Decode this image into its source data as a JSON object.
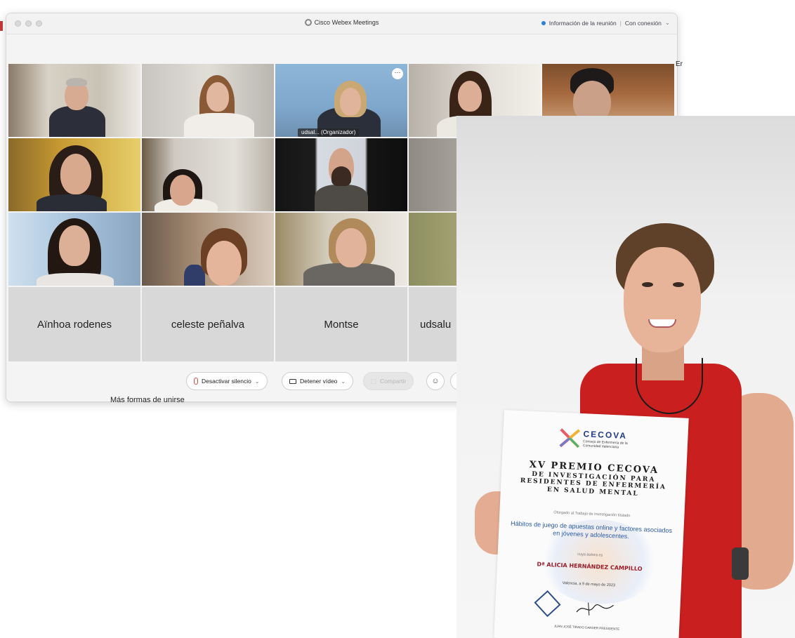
{
  "window": {
    "app_title": "Cisco Webex Meetings",
    "meeting_info": "Información de la reunión",
    "connection": "Con conexión"
  },
  "video_grid": {
    "organizer_label": "udsal...  (Organizador)",
    "more_icon": "⋯"
  },
  "name_tiles": [
    {
      "name": "Aïnhoa rodenes"
    },
    {
      "name": "celeste peñalva"
    },
    {
      "name": "Montse"
    },
    {
      "name": "udsalu"
    }
  ],
  "toolbar": {
    "mute_label": "Desactivar silencio",
    "video_label": "Detener vídeo",
    "share_label": "Compartir"
  },
  "under_text": "Más formas de unirse",
  "edge_text": "Er",
  "certificate": {
    "logo_text": "CECOVA",
    "logo_subtitle": "Consejo de Enfermería de la Comunidad Valenciana",
    "title_line1": "XV PREMIO CECOVA",
    "title_line2": "DE INVESTIGACIÓN PARA",
    "title_line3": "RESIDENTES DE ENFERMERÍA",
    "title_line4": "EN SALUD MENTAL",
    "granted_to_work": "Otorgado al Trabajo de Investigación titulado",
    "work_title": "Hábitos de juego de apuestas online y factores asociados en jóvenes y adolescentes.",
    "author_label": "cuya autora es",
    "winner": "Dª ALICIA HERNÁNDEZ CAMPILLO",
    "date": "Valencia, a 9 de mayo de 2023",
    "signer": "JUAN JOSÉ TIRADO DARDER PRESIDENTE"
  }
}
